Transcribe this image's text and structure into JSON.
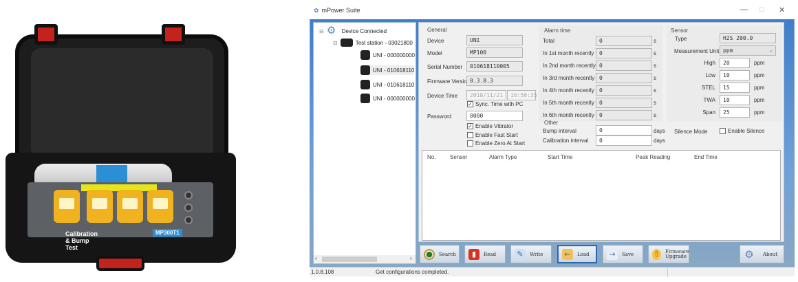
{
  "photo": {
    "panel_text": "Calibration & Bump Test",
    "model_badge": "MP300T1"
  },
  "window": {
    "title": "mPower Suite",
    "minimize": "—",
    "maximize": "□",
    "close": "✕"
  },
  "tree": {
    "root": "Device Connected",
    "station": "Test station - 03021800",
    "devices": [
      "UNI - 000000000",
      "UNI - 010618110",
      "UNI - 010618110",
      "UNI - 000000000"
    ],
    "scroll_left": "‹",
    "scroll_right": "›"
  },
  "general": {
    "title": "General",
    "device_label": "Device",
    "device": "UNI",
    "model_label": "Model",
    "model": "MP100",
    "serial_label": "Serial Number",
    "serial": "010618110005",
    "firmware_label": "Firmware Version",
    "firmware": "0.3.8.3",
    "time_label": "Device Time",
    "date": "2018/11/21",
    "time": "16:50:35",
    "sync_label": "Sync. Time with PC",
    "sync": true,
    "password_label": "Password",
    "password": "0000",
    "vibrator_label": "Enable Vibrator",
    "vibrator": true,
    "fast_start_label": "Enable Fast Start",
    "fast_start": false,
    "zero_label": "Enable Zero At Start",
    "zero": false
  },
  "alarm": {
    "title": "Alarm time",
    "unit": "s",
    "rows": [
      {
        "label": "Total",
        "value": "0"
      },
      {
        "label": "In 1st month recently",
        "value": "0"
      },
      {
        "label": "In 2nd month recently",
        "value": "0"
      },
      {
        "label": "In 3rd month recently",
        "value": "0"
      },
      {
        "label": "In 4th month recently",
        "value": "0"
      },
      {
        "label": "In 5th month recently",
        "value": "0"
      },
      {
        "label": "In 6th month recently",
        "value": "0"
      }
    ]
  },
  "other": {
    "title": "Other",
    "unit": "days",
    "bump_label": "Bump interval",
    "bump": "0",
    "cal_label": "Calibration interval",
    "cal": "0",
    "silence_label": "Silence Mode",
    "silence_cb": "Enable Silence",
    "silence": false
  },
  "sensor": {
    "title": "Sensor",
    "type_label": "Type",
    "type": "H2S 200.0",
    "unit_label": "Measurement Unit",
    "unit": "ppm",
    "rows": [
      {
        "label": "High",
        "value": "20",
        "unit": "ppm"
      },
      {
        "label": "Low",
        "value": "10",
        "unit": "ppm"
      },
      {
        "label": "STEL",
        "value": "15",
        "unit": "ppm"
      },
      {
        "label": "TWA",
        "value": "10",
        "unit": "ppm"
      },
      {
        "label": "Span",
        "value": "25",
        "unit": "ppm"
      }
    ]
  },
  "table": {
    "columns": [
      "No.",
      "Sensor",
      "Alarm Type",
      "Start Time",
      "Peak Reading",
      "End Time"
    ]
  },
  "buttons": {
    "search": "Search",
    "read": "Read",
    "write": "Write",
    "load": "Load",
    "save": "Save",
    "firmware": "Firmware Upgrade",
    "about": "About"
  },
  "status": {
    "version": "1.0.8.108",
    "message": "Get configurations completed."
  }
}
